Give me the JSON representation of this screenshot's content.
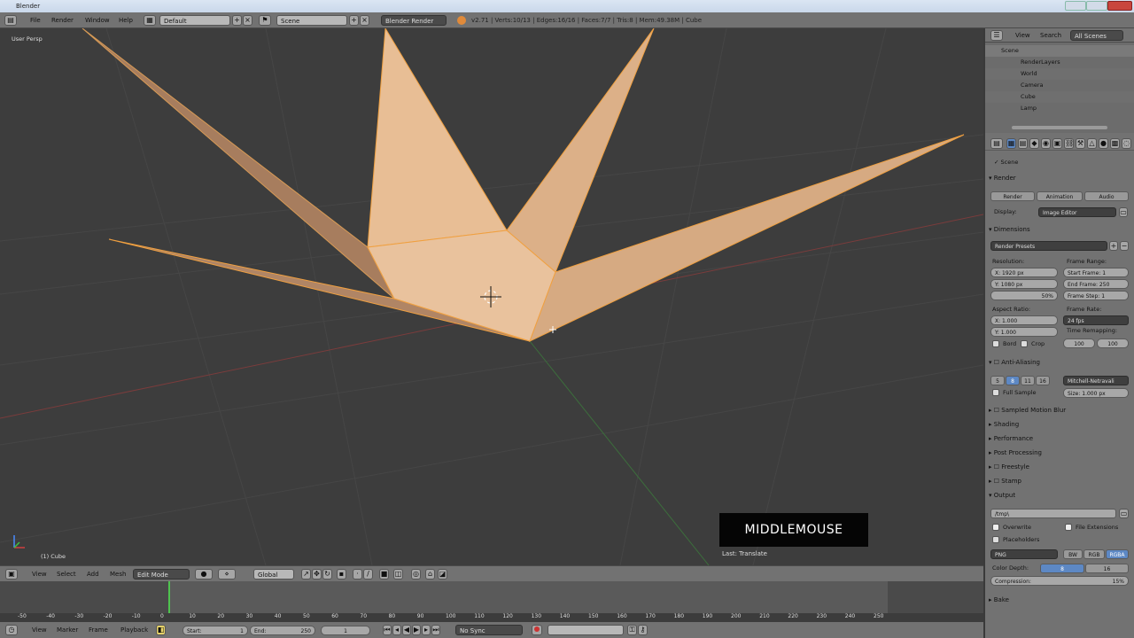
{
  "window": {
    "title": "Blender"
  },
  "menubar": {
    "menus": [
      "File",
      "Render",
      "Window",
      "Help"
    ],
    "layout": "Default",
    "scene": "Scene",
    "engine": "Blender Render",
    "stats": "v2.71 | Verts:10/13 | Edges:16/16 | Faces:7/7 | Tris:8 | Mem:49.38M | Cube"
  },
  "viewport": {
    "label": "User Persp",
    "object_label": "(1) Cube",
    "overlay_key": "MIDDLEMOUSE",
    "last_op": "Last: Translate",
    "colors": {
      "mesh": "#e9b98a",
      "mesh_dark": "#b78a63",
      "edge": "#f0a040",
      "background": "#3d3d3d",
      "red_axis": "#8a3a3a",
      "green_axis": "#3a6a3a"
    }
  },
  "view_header": {
    "menus": [
      "View",
      "Select",
      "Add",
      "Mesh"
    ],
    "mode": "Edit Mode",
    "orientation": "Global"
  },
  "timeline": {
    "ticks": [
      "-50",
      "-40",
      "-30",
      "-20",
      "-10",
      "0",
      "10",
      "20",
      "30",
      "40",
      "50",
      "60",
      "70",
      "80",
      "90",
      "100",
      "110",
      "120",
      "130",
      "140",
      "150",
      "160",
      "170",
      "180",
      "190",
      "200",
      "210",
      "220",
      "230",
      "240",
      "250"
    ],
    "menus": [
      "View",
      "Marker",
      "Frame",
      "Playback"
    ],
    "start_label": "Start:",
    "start_value": "1",
    "end_label": "End:",
    "end_value": "250",
    "current": "1",
    "sync": "No Sync"
  },
  "outliner": {
    "tabs": [
      "View",
      "Search",
      "All Scenes"
    ],
    "items": [
      {
        "label": "Scene"
      },
      {
        "label": "RenderLayers"
      },
      {
        "label": "World"
      },
      {
        "label": "Camera"
      },
      {
        "label": "Cube"
      },
      {
        "label": "Lamp"
      }
    ]
  },
  "properties": {
    "scene": "Scene",
    "render_header": "Render",
    "render_buttons": [
      "Render",
      "Animation",
      "Audio"
    ],
    "display_label": "Display:",
    "display_value": "Image Editor",
    "dimensions_header": "Dimensions",
    "render_presets": "Render Presets",
    "resolution_label": "Resolution:",
    "res_x": "X:   1920 px",
    "res_y": "Y:   1080 px",
    "res_pct": "50%",
    "frame_range_label": "Frame Range:",
    "start_frame": "Start Frame:   1",
    "end_frame": "End Frame:  250",
    "frame_step": "Frame Step:   1",
    "aspect_label": "Aspect Ratio:",
    "aspect_x": "X:   1.000",
    "aspect_y": "Y:   1.000",
    "frame_rate_label": "Frame Rate:",
    "frame_rate": "24 fps",
    "time_remap_label": "Time Remapping:",
    "old": "100",
    "new": "100",
    "border": "Bord",
    "crop": "Crop",
    "aa_header": "Anti-Aliasing",
    "aa_samples": [
      "5",
      "8",
      "11",
      "16"
    ],
    "aa_filter": "Mitchell-Netravali",
    "full_sample": "Full Sample",
    "aa_size": "Size:  1.000 px",
    "collapsed_panels": [
      "Sampled Motion Blur",
      "Shading",
      "Performance",
      "Post Processing",
      "Freestyle",
      "Stamp"
    ],
    "output_header": "Output",
    "output_path": "/tmp\\",
    "overwrite": "Overwrite",
    "file_ext": "File Extensions",
    "placeholders": "Placeholders",
    "format": "PNG",
    "color_modes": [
      "BW",
      "RGB",
      "RGBA"
    ],
    "color_depth_label": "Color Depth:",
    "color_depths": [
      "8",
      "16"
    ],
    "compression": "Compression:",
    "compression_value": "15%",
    "bake_header": "Bake"
  }
}
